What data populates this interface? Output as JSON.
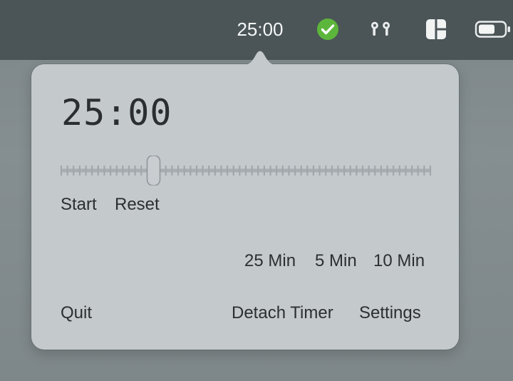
{
  "menubar": {
    "timer": "25:00",
    "icons": [
      "check-circle-icon",
      "airpods-icon",
      "window-layout-icon",
      "battery-icon"
    ],
    "check_color": "#5db63c"
  },
  "popover": {
    "time": "25:00",
    "slider": {
      "value": 25,
      "min": 0,
      "max": 100,
      "ticks": 60
    },
    "start_label": "Start",
    "reset_label": "Reset",
    "presets": [
      "25 Min",
      "5 Min",
      "10 Min"
    ],
    "quit_label": "Quit",
    "detach_label": "Detach Timer",
    "settings_label": "Settings"
  }
}
